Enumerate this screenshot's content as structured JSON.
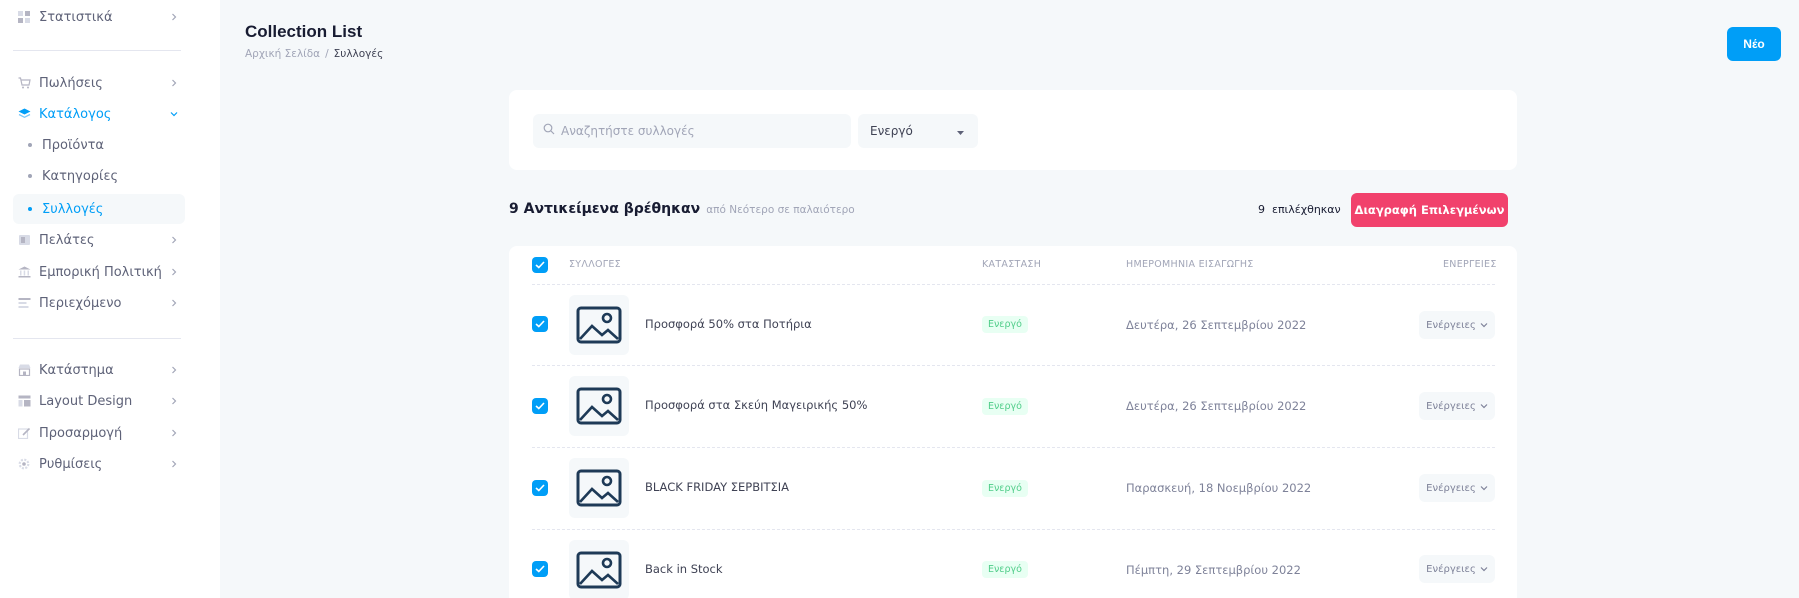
{
  "sidebar": {
    "items": [
      {
        "label": "Στατιστικά",
        "icon": "dashboard-icon"
      },
      {
        "label": "Πωλήσεις",
        "icon": "cart-icon"
      },
      {
        "label": "Κατάλογος",
        "icon": "layers-icon",
        "active": true
      },
      {
        "label": "Πελάτες",
        "icon": "users-icon"
      },
      {
        "label": "Εμπορική Πολιτική",
        "icon": "bank-icon"
      },
      {
        "label": "Περιεχόμενο",
        "icon": "content-icon"
      },
      {
        "label": "Κατάστημα",
        "icon": "store-icon"
      },
      {
        "label": "Layout Design",
        "icon": "layout-icon"
      },
      {
        "label": "Προσαρμογή",
        "icon": "edit-icon"
      },
      {
        "label": "Ρυθμίσεις",
        "icon": "gear-icon"
      }
    ],
    "catalog_sub": [
      {
        "label": "Προϊόντα"
      },
      {
        "label": "Κατηγορίες"
      },
      {
        "label": "Συλλογές",
        "active": true
      }
    ]
  },
  "header": {
    "title": "Collection List",
    "breadcrumb": {
      "home": "Αρχική Σελίδα",
      "separator": "/",
      "current": "Συλλογές"
    },
    "new_button": "Νέο"
  },
  "filters": {
    "search_placeholder": "Αναζητήστε συλλογές",
    "status_value": "Ενεργό"
  },
  "results": {
    "count_label": "9 Αντικείμενα βρέθηκαν",
    "sort_label": "από Νεότερο σε παλαιότερο",
    "selected_label": "9  επιλέχθηκαν",
    "delete_button": "Διαγραφή Επιλεγμένων"
  },
  "table": {
    "headers": {
      "collections": "ΣΥΛΛΟΓΕΣ",
      "status": "ΚΑΤΑΣΤΑΣΗ",
      "date": "ΗΜΕΡΟΜΗΝΙΑ ΕΙΣΑΓΩΓΗΣ",
      "actions": "ΕΝΕΡΓΕΙΕΣ"
    },
    "rows": [
      {
        "name": "Προσφορά 50% στα Ποτήρια",
        "status": "Ενεργό",
        "date": "Δευτέρα, 26 Σεπτεμβρίου 2022",
        "actions": "Ενέργειες"
      },
      {
        "name": "Προσφορά στα Σκεύη Μαγειρικής 50%",
        "status": "Ενεργό",
        "date": "Δευτέρα, 26 Σεπτεμβρίου 2022",
        "actions": "Ενέργειες"
      },
      {
        "name": "BLACK FRIDAY ΣΕΡΒΙΤΣΙΑ",
        "status": "Ενεργό",
        "date": "Παρασκευή, 18 Νοεμβρίου 2022",
        "actions": "Ενέργειες"
      },
      {
        "name": "Back in Stock",
        "status": "Ενεργό",
        "date": "Πέμπτη, 29 Σεπτεμβρίου 2022",
        "actions": "Ενέργειες"
      }
    ]
  },
  "colors": {
    "primary": "#009ef7",
    "danger": "#f1416c",
    "success": "#50cd89",
    "success_bg": "#e8fff3"
  }
}
